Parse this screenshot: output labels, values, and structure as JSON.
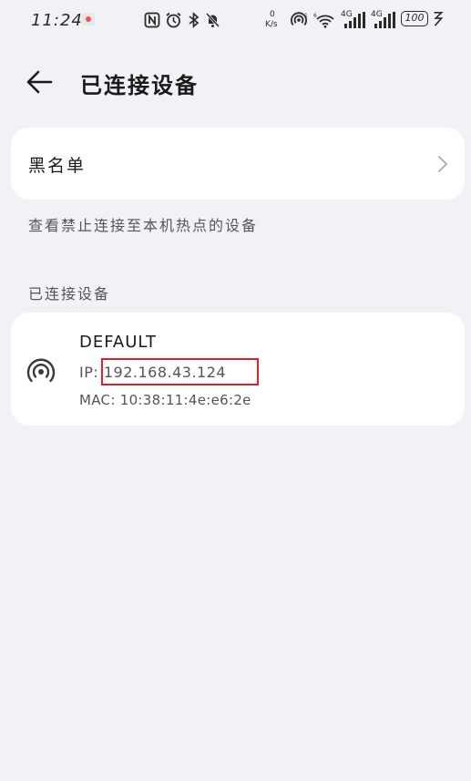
{
  "status_bar": {
    "time": "11:24",
    "net_speed_value": "0",
    "net_speed_unit": "K/s",
    "signal1_label": "4G",
    "signal2_label": "4G",
    "battery": "100"
  },
  "header": {
    "title": "已连接设备"
  },
  "blacklist": {
    "label": "黑名单",
    "hint": "查看禁止连接至本机热点的设备"
  },
  "connected_section": {
    "title": "已连接设备"
  },
  "device": {
    "name": "DEFAULT",
    "ip_label": "IP: ",
    "ip_value": "192.168.43.124",
    "mac_label": "MAC: ",
    "mac_value": "10:38:11:4e:e6:2e"
  },
  "colors": {
    "background": "#f1f2f6",
    "card": "#ffffff",
    "highlight": "#d9232b"
  },
  "icons": {
    "back": "back-arrow-icon",
    "chevron": "chevron-right-icon",
    "hotspot": "hotspot-icon"
  }
}
